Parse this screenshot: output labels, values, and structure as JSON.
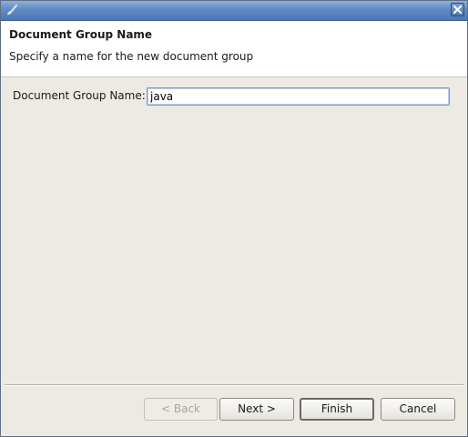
{
  "window": {
    "icon": "paintbrush-icon",
    "close_icon": "close-icon"
  },
  "banner": {
    "title": "Document Group Name",
    "description": "Specify a name for the new document group"
  },
  "form": {
    "label": "Document Group Name:",
    "value": "java"
  },
  "buttons": {
    "back": "< Back",
    "next": "Next >",
    "finish": "Finish",
    "cancel": "Cancel"
  }
}
